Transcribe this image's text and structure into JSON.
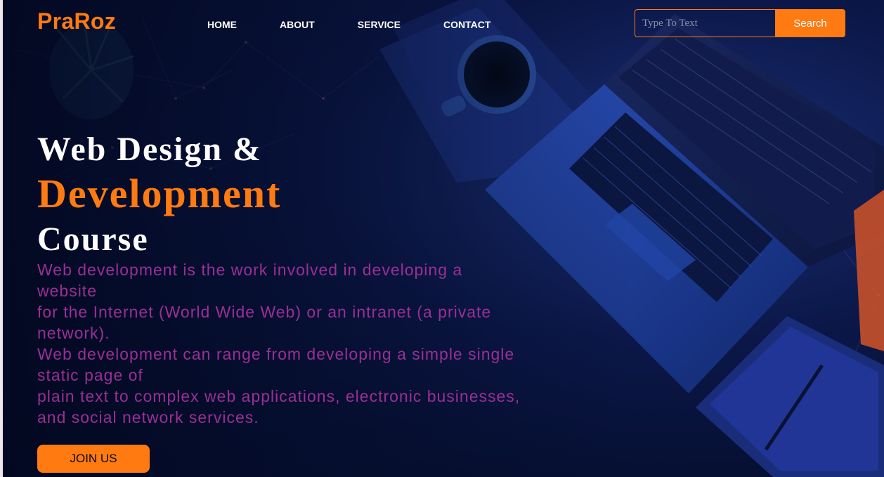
{
  "brand": {
    "logo": "PraRoz",
    "accent_color": "#ff7a10",
    "description_color": "#9a2f95"
  },
  "nav": {
    "items": [
      "HOME",
      "ABOUT",
      "SERVICE",
      "CONTACT"
    ]
  },
  "search": {
    "placeholder": "Type To Text",
    "value": "",
    "button_label": "Search",
    "icon": "search-icon"
  },
  "hero": {
    "line1": "Web Design &",
    "line2": "Development",
    "line3": "Course",
    "description": [
      "Web development is the work involved in developing a website",
      "for the Internet (World Wide Web) or an intranet (a private network).",
      "Web development can range from developing a simple single static page of",
      "plain text to complex web applications, electronic businesses, and social network services."
    ],
    "cta_label": "JOIN US"
  },
  "background": {
    "image_subject": "laptop-coffee-desk-photo"
  }
}
